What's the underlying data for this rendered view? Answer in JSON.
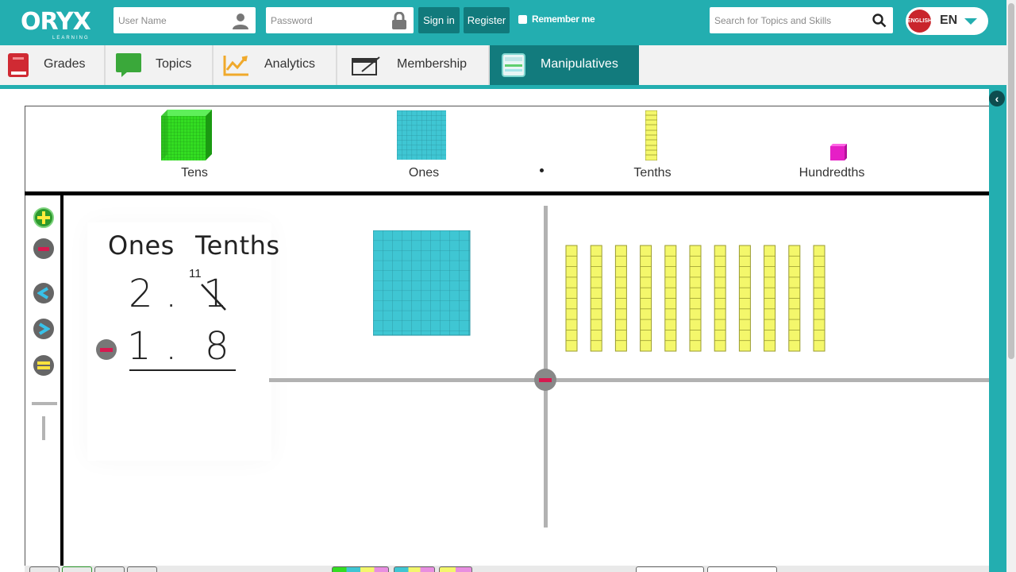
{
  "header": {
    "logo_text": "ORYX",
    "logo_subtext": "LEARNING",
    "username_placeholder": "User Name",
    "password_placeholder": "Password",
    "signin_label": "Sign in",
    "register_label": "Register",
    "remember_label": "Remember me",
    "search_placeholder": "Search for Topics and Skills",
    "language_flag": "ENGLISH",
    "language_code": "EN"
  },
  "nav": {
    "items": [
      {
        "label": "Grades",
        "icon": "book-icon",
        "color": "#d02a33"
      },
      {
        "label": "Topics",
        "icon": "chat-bubble-icon",
        "color": "#3aa83a"
      },
      {
        "label": "Analytics",
        "icon": "line-chart-icon",
        "color": "#f0a92b"
      },
      {
        "label": "Membership",
        "icon": "membership-card-icon",
        "color": "#333333"
      },
      {
        "label": "Manipulatives",
        "icon": "manipulatives-icon",
        "color": "#ffffff"
      }
    ],
    "active": "Manipulatives"
  },
  "palette": {
    "tens_label": "Tens",
    "ones_label": "Ones",
    "tenths_label": "Tenths",
    "hundredths_label": "Hundredths"
  },
  "problem": {
    "col_ones": "Ones",
    "col_tenths": "Tenths",
    "top_ones": "2",
    "top_point": ".",
    "top_tenths": "1",
    "regroup_mark": "11",
    "bottom_ones": "1",
    "bottom_point": ".",
    "bottom_tenths": "8"
  },
  "colors": {
    "brand_teal": "#23aeb0",
    "dark_teal": "#127b7d",
    "tens_green": "#33dd22",
    "ones_cyan": "#3fc6d3",
    "tenths_yellow": "#f4f76b",
    "hundredths_magenta": "#e61fc6",
    "minus_red": "#d6194f"
  },
  "workspace": {
    "ones_blocks": 1,
    "tenths_rods": 11
  }
}
